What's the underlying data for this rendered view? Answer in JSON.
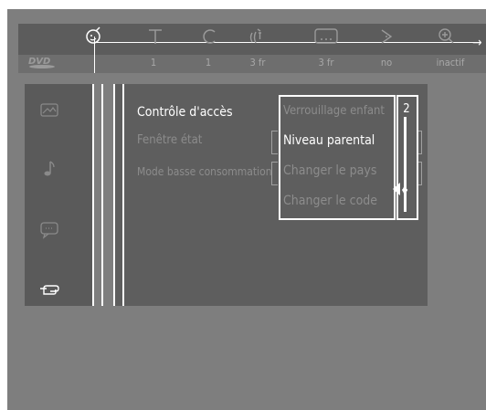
{
  "top_bar": {
    "icons": [
      "subtitle-face-icon",
      "title-icon",
      "chapter-icon",
      "audio-icon",
      "subtitle-box-icon",
      "angle-icon",
      "zoom-icon"
    ],
    "values": [
      "1",
      "1",
      "3 fr",
      "3 fr",
      "no",
      "inactif"
    ],
    "logo_text": "DVD"
  },
  "sidebar": {
    "icons": [
      "picture-icon",
      "music-note-icon",
      "speech-bubble-icon",
      "hand-pointer-icon"
    ]
  },
  "menu": {
    "items": [
      "Contrôle d'accès",
      "Fenêtre état",
      "Mode basse consommation"
    ],
    "selected_index": 0
  },
  "submenu": {
    "items": [
      "Verrouillage enfant",
      "Niveau parental",
      "Changer le pays",
      "Changer le code"
    ],
    "highlighted_index": 1
  },
  "level_value": "2",
  "level_selector": {
    "max_level": 8,
    "value": 2
  },
  "colors": {
    "background": "#7e7e7e",
    "panel": "#5e5e5e",
    "text_active": "#ffffff",
    "text_inactive": "#8c8c8c"
  }
}
